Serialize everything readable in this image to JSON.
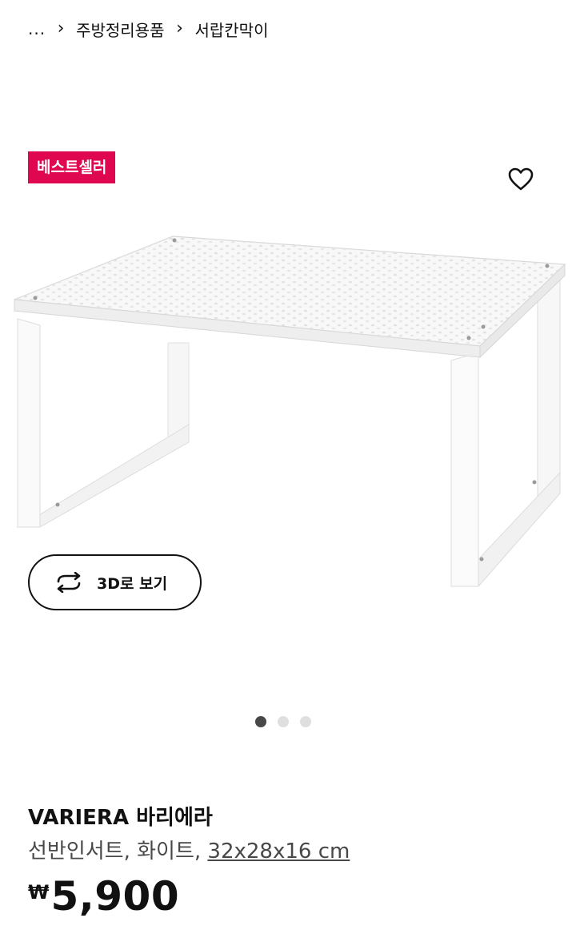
{
  "breadcrumb": {
    "ellipsis": "...",
    "items": [
      "주방정리용품",
      "서랍칸막이"
    ]
  },
  "badge": "베스트셀러",
  "icons": {
    "favorite": "heart-outline-icon",
    "rotate_3d": "rotate-arrows-icon",
    "chevron": "chevron-right-icon"
  },
  "view3d_label": "3D로 보기",
  "carousel": {
    "total": 3,
    "active": 1
  },
  "product": {
    "name": "VARIERA 바리에라",
    "description_prefix": "선반인서트, 화이트, ",
    "dimensions": "32x28x16 cm",
    "currency": "₩",
    "price": "5,900"
  },
  "colors": {
    "badge": "#e00751",
    "text": "#111111",
    "secondary_text": "#484848",
    "dot_active": "#484848",
    "dot_inactive": "#dfdfdf"
  }
}
